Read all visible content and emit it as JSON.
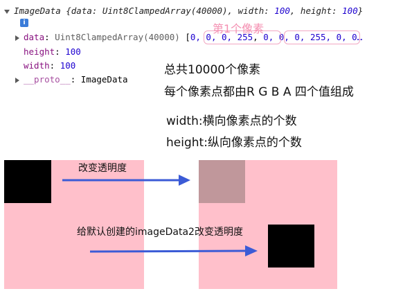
{
  "console": {
    "summary": {
      "label": "ImageData {data: Uint8ClampedArray(40000), width: ",
      "width": "100",
      "sep": ", height: ",
      "height": "100",
      "end": "}"
    },
    "info_icon": "i",
    "data_row": {
      "key": "data",
      "colon": ":",
      "type": "Uint8ClampedArray(40000)",
      "open": "[",
      "group1": "0, 0, 0, 255",
      "comma": ",",
      "group2": "0, 0, 0, 255",
      "rest": ", 0, 0…"
    },
    "height_row": {
      "key": "height",
      "colon": ":",
      "value": "100"
    },
    "width_row": {
      "key": "width",
      "colon": ":",
      "value": "100"
    },
    "proto_row": {
      "key": "__proto__",
      "colon": ":",
      "value": "ImageData"
    }
  },
  "annotation_first_pixel": "第1个像素",
  "notes": {
    "total": "总共10000个像素",
    "rgba": "每个像素点都由R G B A 四个值组成",
    "width": "width:横向像素点的个数",
    "height": "height:纵向像素点的个数"
  },
  "canvas_labels": {
    "change_opacity": "改变透明度",
    "default_change": "给默认创建的imageData2改变透明度"
  },
  "colors": {
    "canvas_bg": "#ffc0cb",
    "arrow": "#3b5bd6",
    "faded_square": "#c0979b",
    "annotation": "#f48fb1"
  }
}
